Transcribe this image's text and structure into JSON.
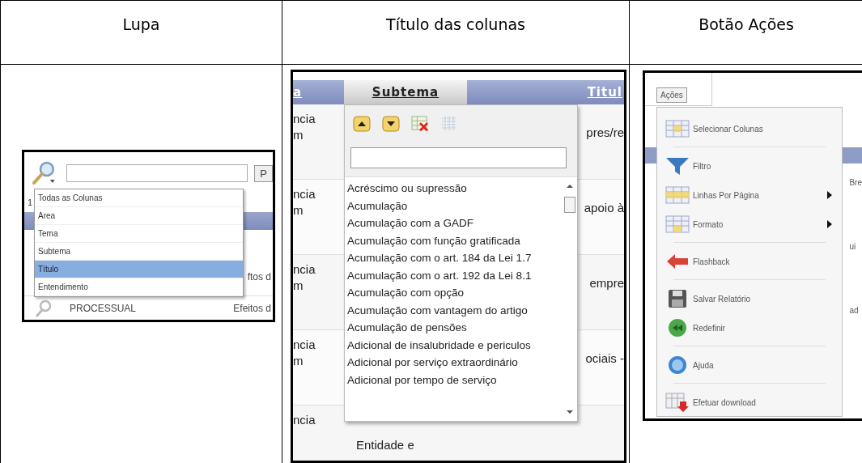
{
  "document_table": {
    "headers": [
      "Lupa",
      "Título das colunas",
      "Botão Ações"
    ]
  },
  "lupa_panel": {
    "button_label": "P",
    "row_marker": "1",
    "menu": [
      {
        "label": "Todas as Colunas",
        "selected": false
      },
      {
        "label": "Area",
        "selected": false
      },
      {
        "label": "Tema",
        "selected": false
      },
      {
        "label": "Subtema",
        "selected": false
      },
      {
        "label": "Título",
        "selected": true
      },
      {
        "label": "Entendimento",
        "selected": false
      }
    ],
    "rows": [
      {
        "column_2": "ftos d"
      },
      {
        "column_1": "PROCESSUAL",
        "column_2": "Efeitos d"
      }
    ]
  },
  "columns_panel": {
    "header": [
      {
        "label": "a",
        "selected": false
      },
      {
        "label": "Subtema",
        "selected": true
      },
      {
        "label": "Titul",
        "selected": false
      }
    ],
    "rows": [
      {
        "column_1": [
          "ncia",
          "m"
        ],
        "column_3": "pres/re"
      },
      {
        "column_1": [
          "ncia",
          "m"
        ],
        "column_3": "apoio à"
      },
      {
        "column_1": [
          "ncia",
          "m"
        ],
        "column_3": "empre"
      },
      {
        "column_1": [
          "ncia",
          "m"
        ],
        "column_3": "ociais -"
      },
      {
        "column_1": [
          "ncia"
        ],
        "column_2": "Entidade e"
      }
    ],
    "options": [
      "Acréscimo ou supressão",
      "Acumulação",
      "Acumulação com a GADF",
      "Acumulação com função gratificada",
      "Acumulação com o art. 184 da Lei 1.7",
      "Acumulação com o art. 192 da Lei 8.1",
      "Acumulação com opção",
      "Acumulação com vantagem do artigo",
      "Acumulação de pensões",
      "Adicional de insalubridade e periculos",
      "Adicional por serviço extraordinário",
      "Adicional por tempo de serviço"
    ]
  },
  "actions_panel": {
    "button_label": "Ações",
    "menu": [
      {
        "label": "Selecionar Colunas",
        "submenu": false,
        "separator_after": true
      },
      {
        "label": "Filtro",
        "submenu": false,
        "separator_after": false
      },
      {
        "label": "Linhas Por Página",
        "submenu": true,
        "separator_after": false
      },
      {
        "label": "Formato",
        "submenu": true,
        "separator_after": true
      },
      {
        "label": "Flashback",
        "submenu": false,
        "separator_after": true
      },
      {
        "label": "Salvar Relatório",
        "submenu": false,
        "separator_after": false
      },
      {
        "label": "Redefinir",
        "submenu": false,
        "separator_after": true
      },
      {
        "label": "Ajuda",
        "submenu": false,
        "separator_after": true
      },
      {
        "label": "Efetuar download",
        "submenu": false,
        "separator_after": false
      }
    ],
    "side_fragments": [
      "Bre",
      "ui",
      "ad"
    ]
  }
}
